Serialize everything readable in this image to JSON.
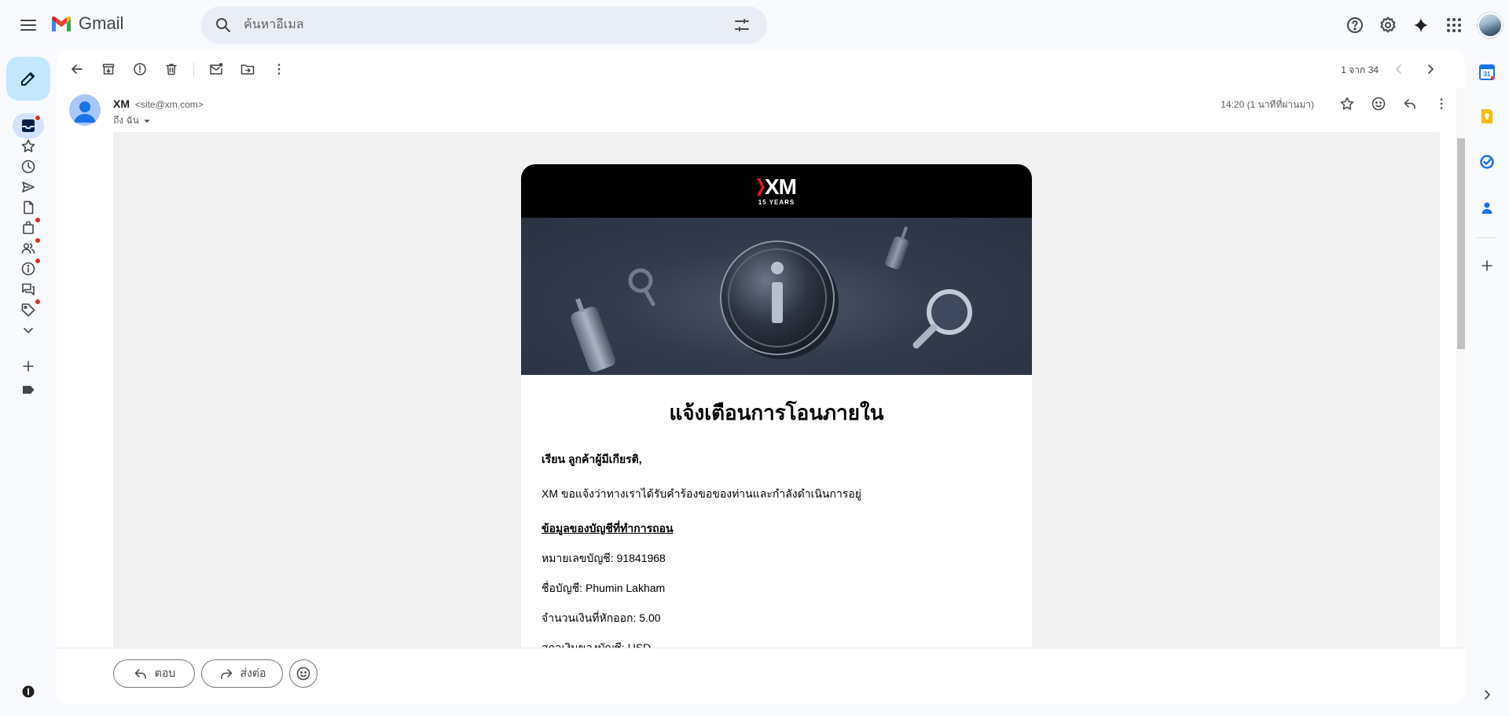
{
  "app": {
    "name": "Gmail"
  },
  "search": {
    "placeholder": "ค้นหาอีเมล"
  },
  "toolbar": {
    "pager": "1 จาก 34"
  },
  "message": {
    "sender_name": "XM",
    "sender_email": "<site@xm.com>",
    "to": "ถึง ฉัน",
    "time": "14:20 (1 นาทีที่ผ่านมา)"
  },
  "email": {
    "logo_text": "XM",
    "logo_sub": "15 YEARS",
    "title": "แจ้งเตือนการโอนภายใน",
    "greeting": "เรียน ลูกค้าผู้มีเกียรติ,",
    "intro": "XM ขอแจ้งว่าทางเราได้รับคำร้องขอของท่านและกำลังดำเนินการอยู่",
    "section_heading": "ข้อมูลของบัญชีที่ทำการถอน",
    "rows": [
      "หมายเลขบัญชี: 91841968",
      "ชื่อบัญชี: Phumin Lakham",
      "จำนวนเงินที่หักออก: 5.00",
      "สกุลเงินของบัญชี: USD"
    ]
  },
  "reply_bar": {
    "reply": "ตอบ",
    "forward": "ส่งต่อ"
  },
  "colors": {
    "compose_bg": "#c2e7ff",
    "active_bg": "#d3e3fd",
    "notify_dot": "#d93025",
    "email_header_bg": "#000000",
    "xm_red": "#e21a22"
  }
}
